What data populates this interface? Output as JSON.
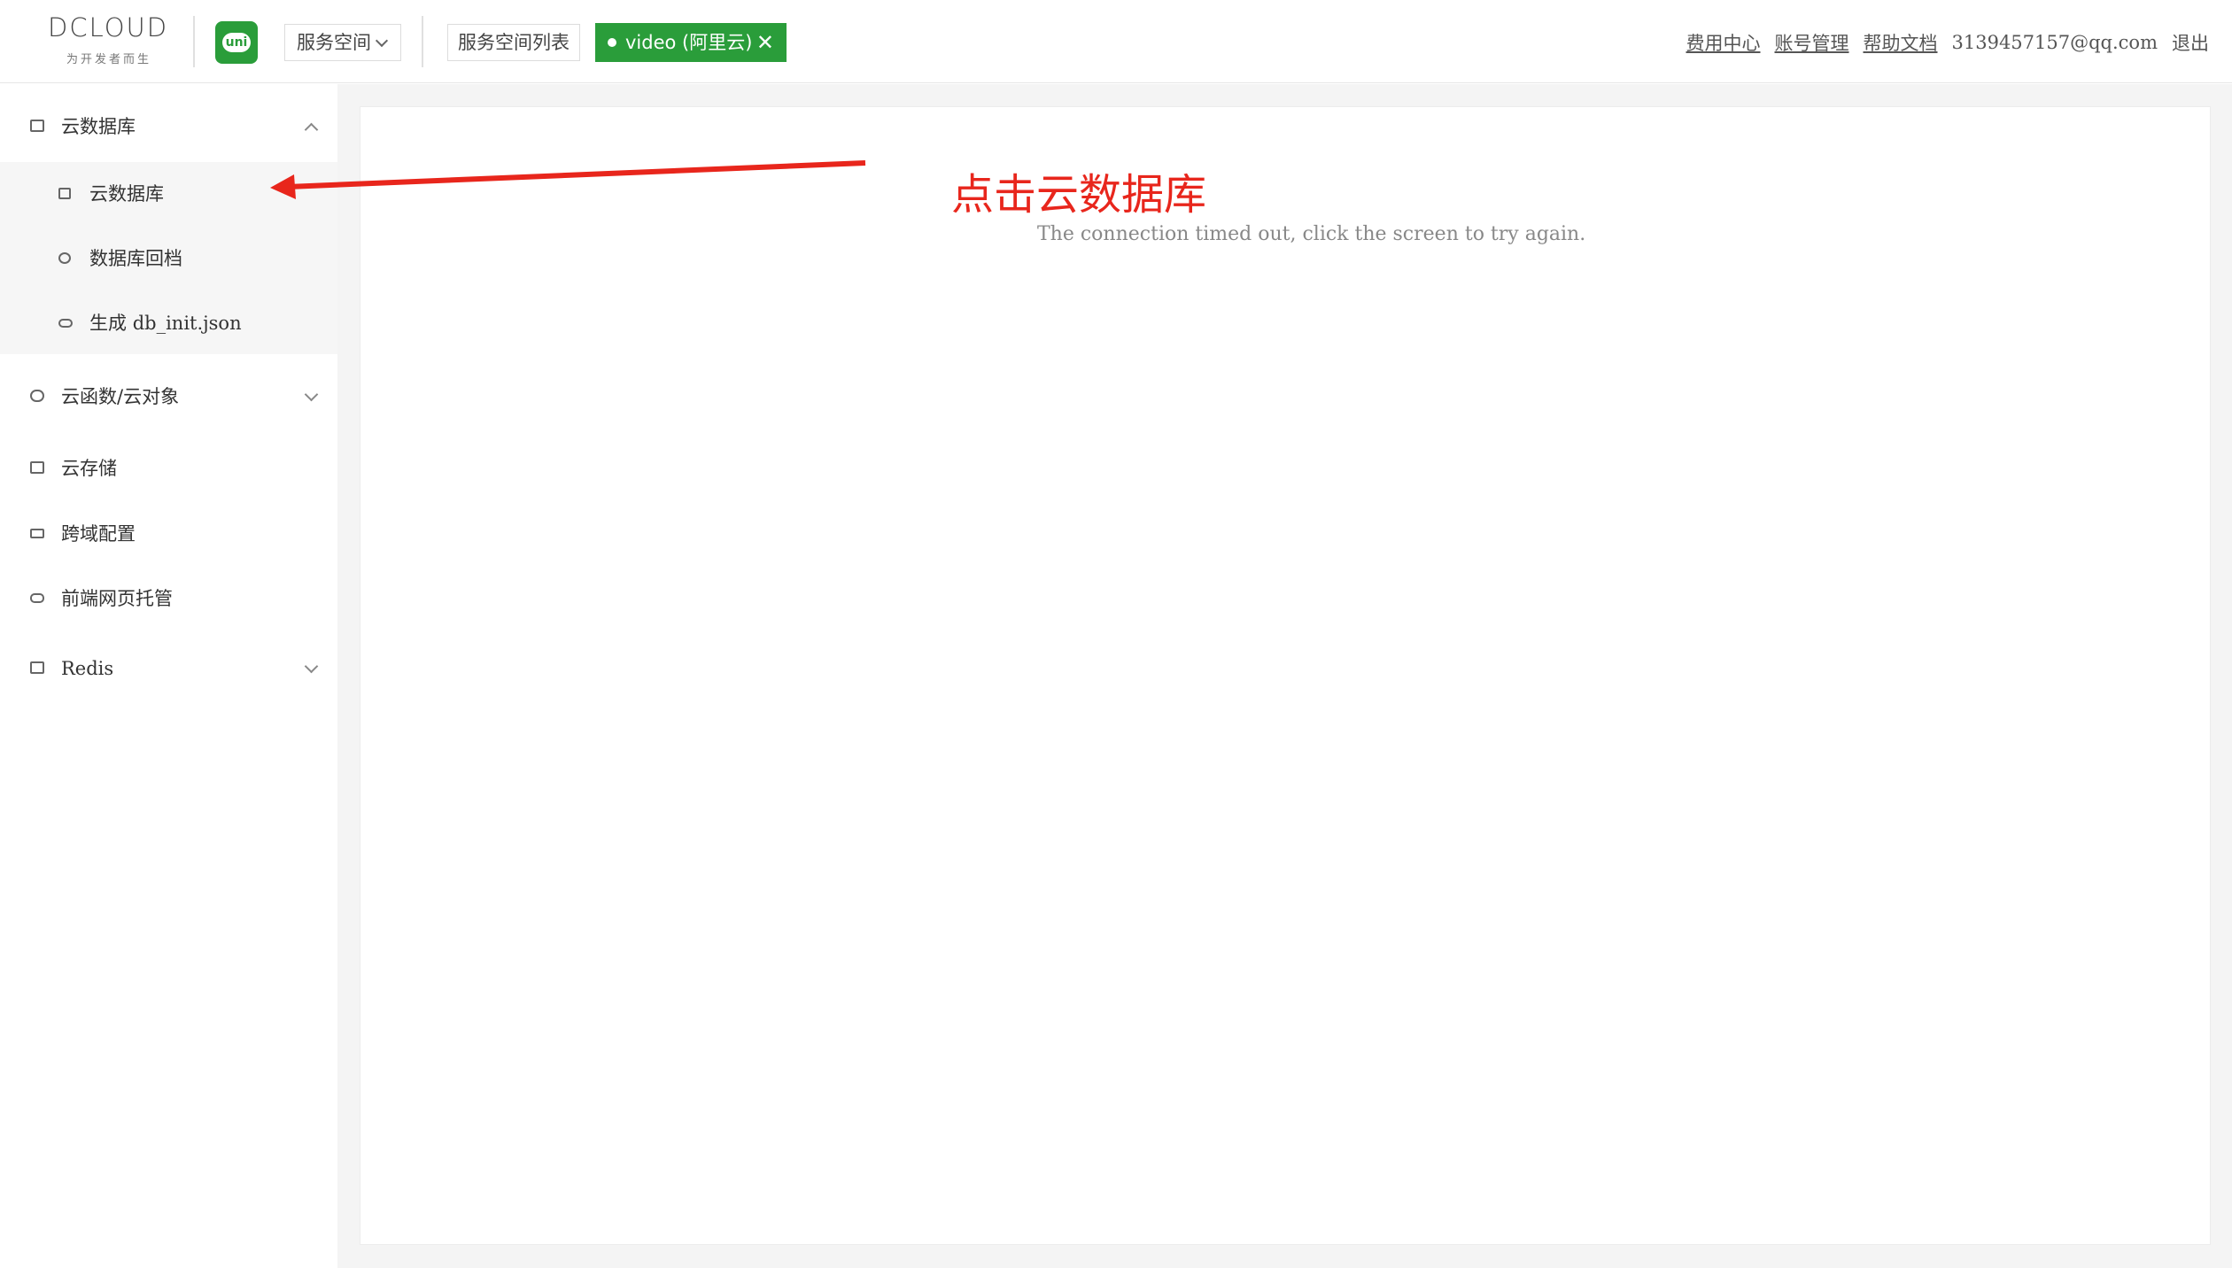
{
  "header": {
    "logo_text": "DCLOUD",
    "logo_tagline": "为开发者而生",
    "uni_icon_text": "uni",
    "space_select_label": "服务空间",
    "space_list_label": "服务空间列表",
    "active_space_tag": "video (阿里云)",
    "active_space_close": "✕",
    "links": {
      "billing": "费用中心",
      "account": "账号管理",
      "docs": "帮助文档",
      "email": "3139457157@qq.com",
      "logout": "退出"
    }
  },
  "sidebar": {
    "items": [
      {
        "label": "云数据库",
        "icon": "database-icon",
        "expanded": true
      },
      {
        "label": "云函数/云对象",
        "icon": "cloud-icon",
        "expanded": false
      },
      {
        "label": "云存储",
        "icon": "storage-icon"
      },
      {
        "label": "跨域配置",
        "icon": "cors-icon"
      },
      {
        "label": "前端网页托管",
        "icon": "hosting-icon"
      },
      {
        "label": "Redis",
        "icon": "redis-icon",
        "expanded": false
      }
    ],
    "database_sub": [
      {
        "label": "云数据库",
        "icon": "database-icon"
      },
      {
        "label": "数据库回档",
        "icon": "rollback-icon"
      },
      {
        "label_cn": "生成",
        "label_en": "db_init.json",
        "icon": "link-icon"
      }
    ]
  },
  "main": {
    "timeout_message": "The connection timed out, click the screen to try again.",
    "annotation_text": "点击云数据库"
  },
  "colors": {
    "brand_green": "#2a9d3a",
    "annotation_red": "#e8261c",
    "logo_orange": "#f08a24"
  }
}
